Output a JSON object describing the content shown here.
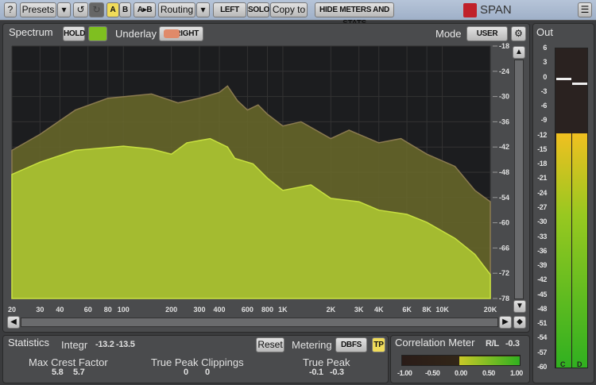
{
  "toolbar": {
    "help": "?",
    "presets": "Presets",
    "dropdown": "▾",
    "undo": "↺",
    "redo": "↻",
    "a": "A",
    "b": "B",
    "ab": "A▸B",
    "routing": "Routing",
    "left": "LEFT",
    "solo": "SOLO",
    "copy_to": "Copy to",
    "hide": "HIDE METERS AND STATS",
    "brand": "SPAN",
    "menu": "☰"
  },
  "spectrum": {
    "tab": "Spectrum",
    "hold": "HOLD",
    "underlay_label": "Underlay",
    "underlay_value": "RIGHT",
    "mode_label": "Mode",
    "mode_value": "USER",
    "colors": {
      "main": "#a8c030",
      "underlay": "#7a7a30",
      "hold": "#7fbf20",
      "right": "#e08a6a"
    }
  },
  "out": {
    "tab": "Out",
    "scale": [
      "6",
      "3",
      "0",
      "-3",
      "-6",
      "-9",
      "-12",
      "-15",
      "-18",
      "-21",
      "-24",
      "-27",
      "-30",
      "-33",
      "-36",
      "-39",
      "-42",
      "-45",
      "-48",
      "-51",
      "-54",
      "-57",
      "-60"
    ],
    "channels": [
      "C",
      "D"
    ],
    "level_db": [
      -11.5,
      -11.5
    ],
    "peak_db": [
      0,
      -1
    ]
  },
  "chart_data": {
    "type": "area",
    "xscale": "log",
    "xlim": [
      20,
      20000
    ],
    "ylim": [
      -78,
      -18
    ],
    "x_ticks": [
      "20",
      "30",
      "40",
      "60",
      "80",
      "100",
      "200",
      "300",
      "400",
      "600",
      "800",
      "1K",
      "2K",
      "3K",
      "4K",
      "6K",
      "8K",
      "10K",
      "20K"
    ],
    "x_tick_values": [
      20,
      30,
      40,
      60,
      80,
      100,
      200,
      300,
      400,
      600,
      800,
      1000,
      2000,
      3000,
      4000,
      6000,
      8000,
      10000,
      20000
    ],
    "y_ticks": [
      "-18",
      "-24",
      "-30",
      "-36",
      "-42",
      "-48",
      "-54",
      "-60",
      "-66",
      "-72",
      "-78"
    ],
    "series": [
      {
        "name": "underlay",
        "freq": [
          20,
          30,
          50,
          80,
          150,
          220,
          300,
          400,
          450,
          520,
          600,
          700,
          800,
          1000,
          1300,
          2000,
          2600,
          4000,
          5500,
          8000,
          12000,
          16000,
          20000
        ],
        "db": [
          -42.8,
          -39,
          -33.2,
          -30.4,
          -29.4,
          -31.5,
          -30.4,
          -29,
          -27.5,
          -31,
          -33.2,
          -32,
          -34.2,
          -37,
          -36,
          -40,
          -38,
          -41,
          -40,
          -43.7,
          -46.6,
          -52.3,
          -55
        ]
      },
      {
        "name": "main",
        "freq": [
          20,
          30,
          50,
          100,
          150,
          200,
          250,
          350,
          450,
          500,
          650,
          800,
          1000,
          1500,
          2000,
          3000,
          4000,
          6000,
          8000,
          12000,
          16000,
          20000
        ],
        "db": [
          -48.5,
          -45.6,
          -42.8,
          -41.8,
          -42.5,
          -43.7,
          -41,
          -40,
          -42,
          -44.7,
          -46,
          -49.4,
          -52.3,
          -51,
          -54.2,
          -55,
          -57,
          -58,
          -59.9,
          -63.7,
          -67.5,
          -72.3
        ]
      }
    ]
  },
  "stats": {
    "tab": "Statistics",
    "integr_label": "Integr",
    "integr": [
      "-13.2",
      "-13.5"
    ],
    "reset": "Reset",
    "metering_label": "Metering",
    "metering": "DBFS",
    "tp": "TP",
    "crest_label": "Max Crest Factor",
    "crest": [
      "5.8",
      "5.7"
    ],
    "clip_label": "True Peak Clippings",
    "clip": [
      "0",
      "0"
    ],
    "tp_label": "True Peak",
    "tpv": [
      "-0.1",
      "-0.3"
    ]
  },
  "corr": {
    "tab": "Correlation Meter",
    "rl_label": "R/L",
    "rl": "-0.3",
    "scale": [
      "-1.00",
      "-0.50",
      "0.00",
      "0.50",
      "1.00"
    ]
  }
}
